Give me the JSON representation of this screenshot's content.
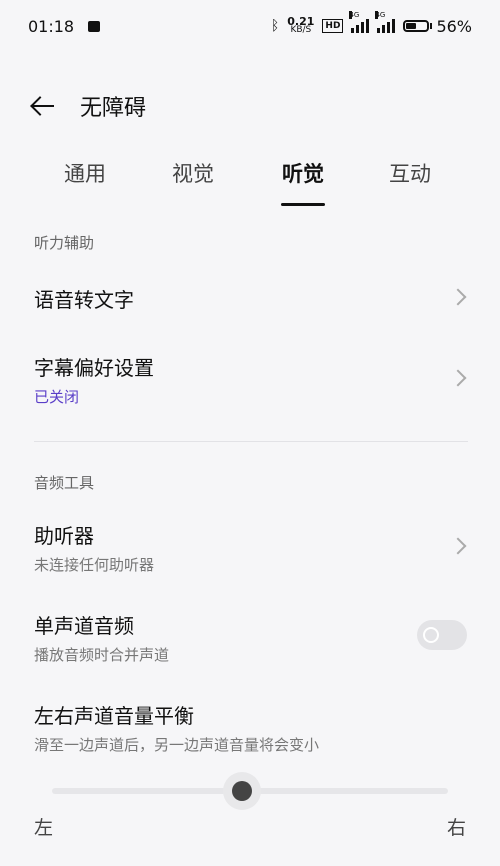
{
  "status_bar": {
    "time": "01:18",
    "net_speed_value": "0.21",
    "net_speed_unit": "KB/S",
    "hd_badge": "HD",
    "signal1_tag": "4G",
    "signal2_tag": "4G",
    "battery_percent": "56%",
    "battery_level": 0.56
  },
  "header": {
    "title": "无障碍"
  },
  "tabs": [
    {
      "label": "通用",
      "active": false
    },
    {
      "label": "视觉",
      "active": false
    },
    {
      "label": "听觉",
      "active": true
    },
    {
      "label": "互动",
      "active": false
    }
  ],
  "sections": {
    "hearing_assist": {
      "label": "听力辅助",
      "speech_to_text": {
        "title": "语音转文字"
      },
      "caption_prefs": {
        "title": "字幕偏好设置",
        "status": "已关闭"
      }
    },
    "audio_tools": {
      "label": "音频工具",
      "hearing_aid": {
        "title": "助听器",
        "subtitle": "未连接任何助听器"
      },
      "mono_audio": {
        "title": "单声道音频",
        "subtitle": "播放音频时合并声道",
        "enabled": false
      },
      "balance": {
        "title": "左右声道音量平衡",
        "subtitle": "滑至一边声道后，另一边声道音量将会变小",
        "left_label": "左",
        "right_label": "右",
        "value": 0.5
      }
    }
  },
  "colors": {
    "background": "#f6f6f8",
    "accent": "#5a3ec8"
  }
}
